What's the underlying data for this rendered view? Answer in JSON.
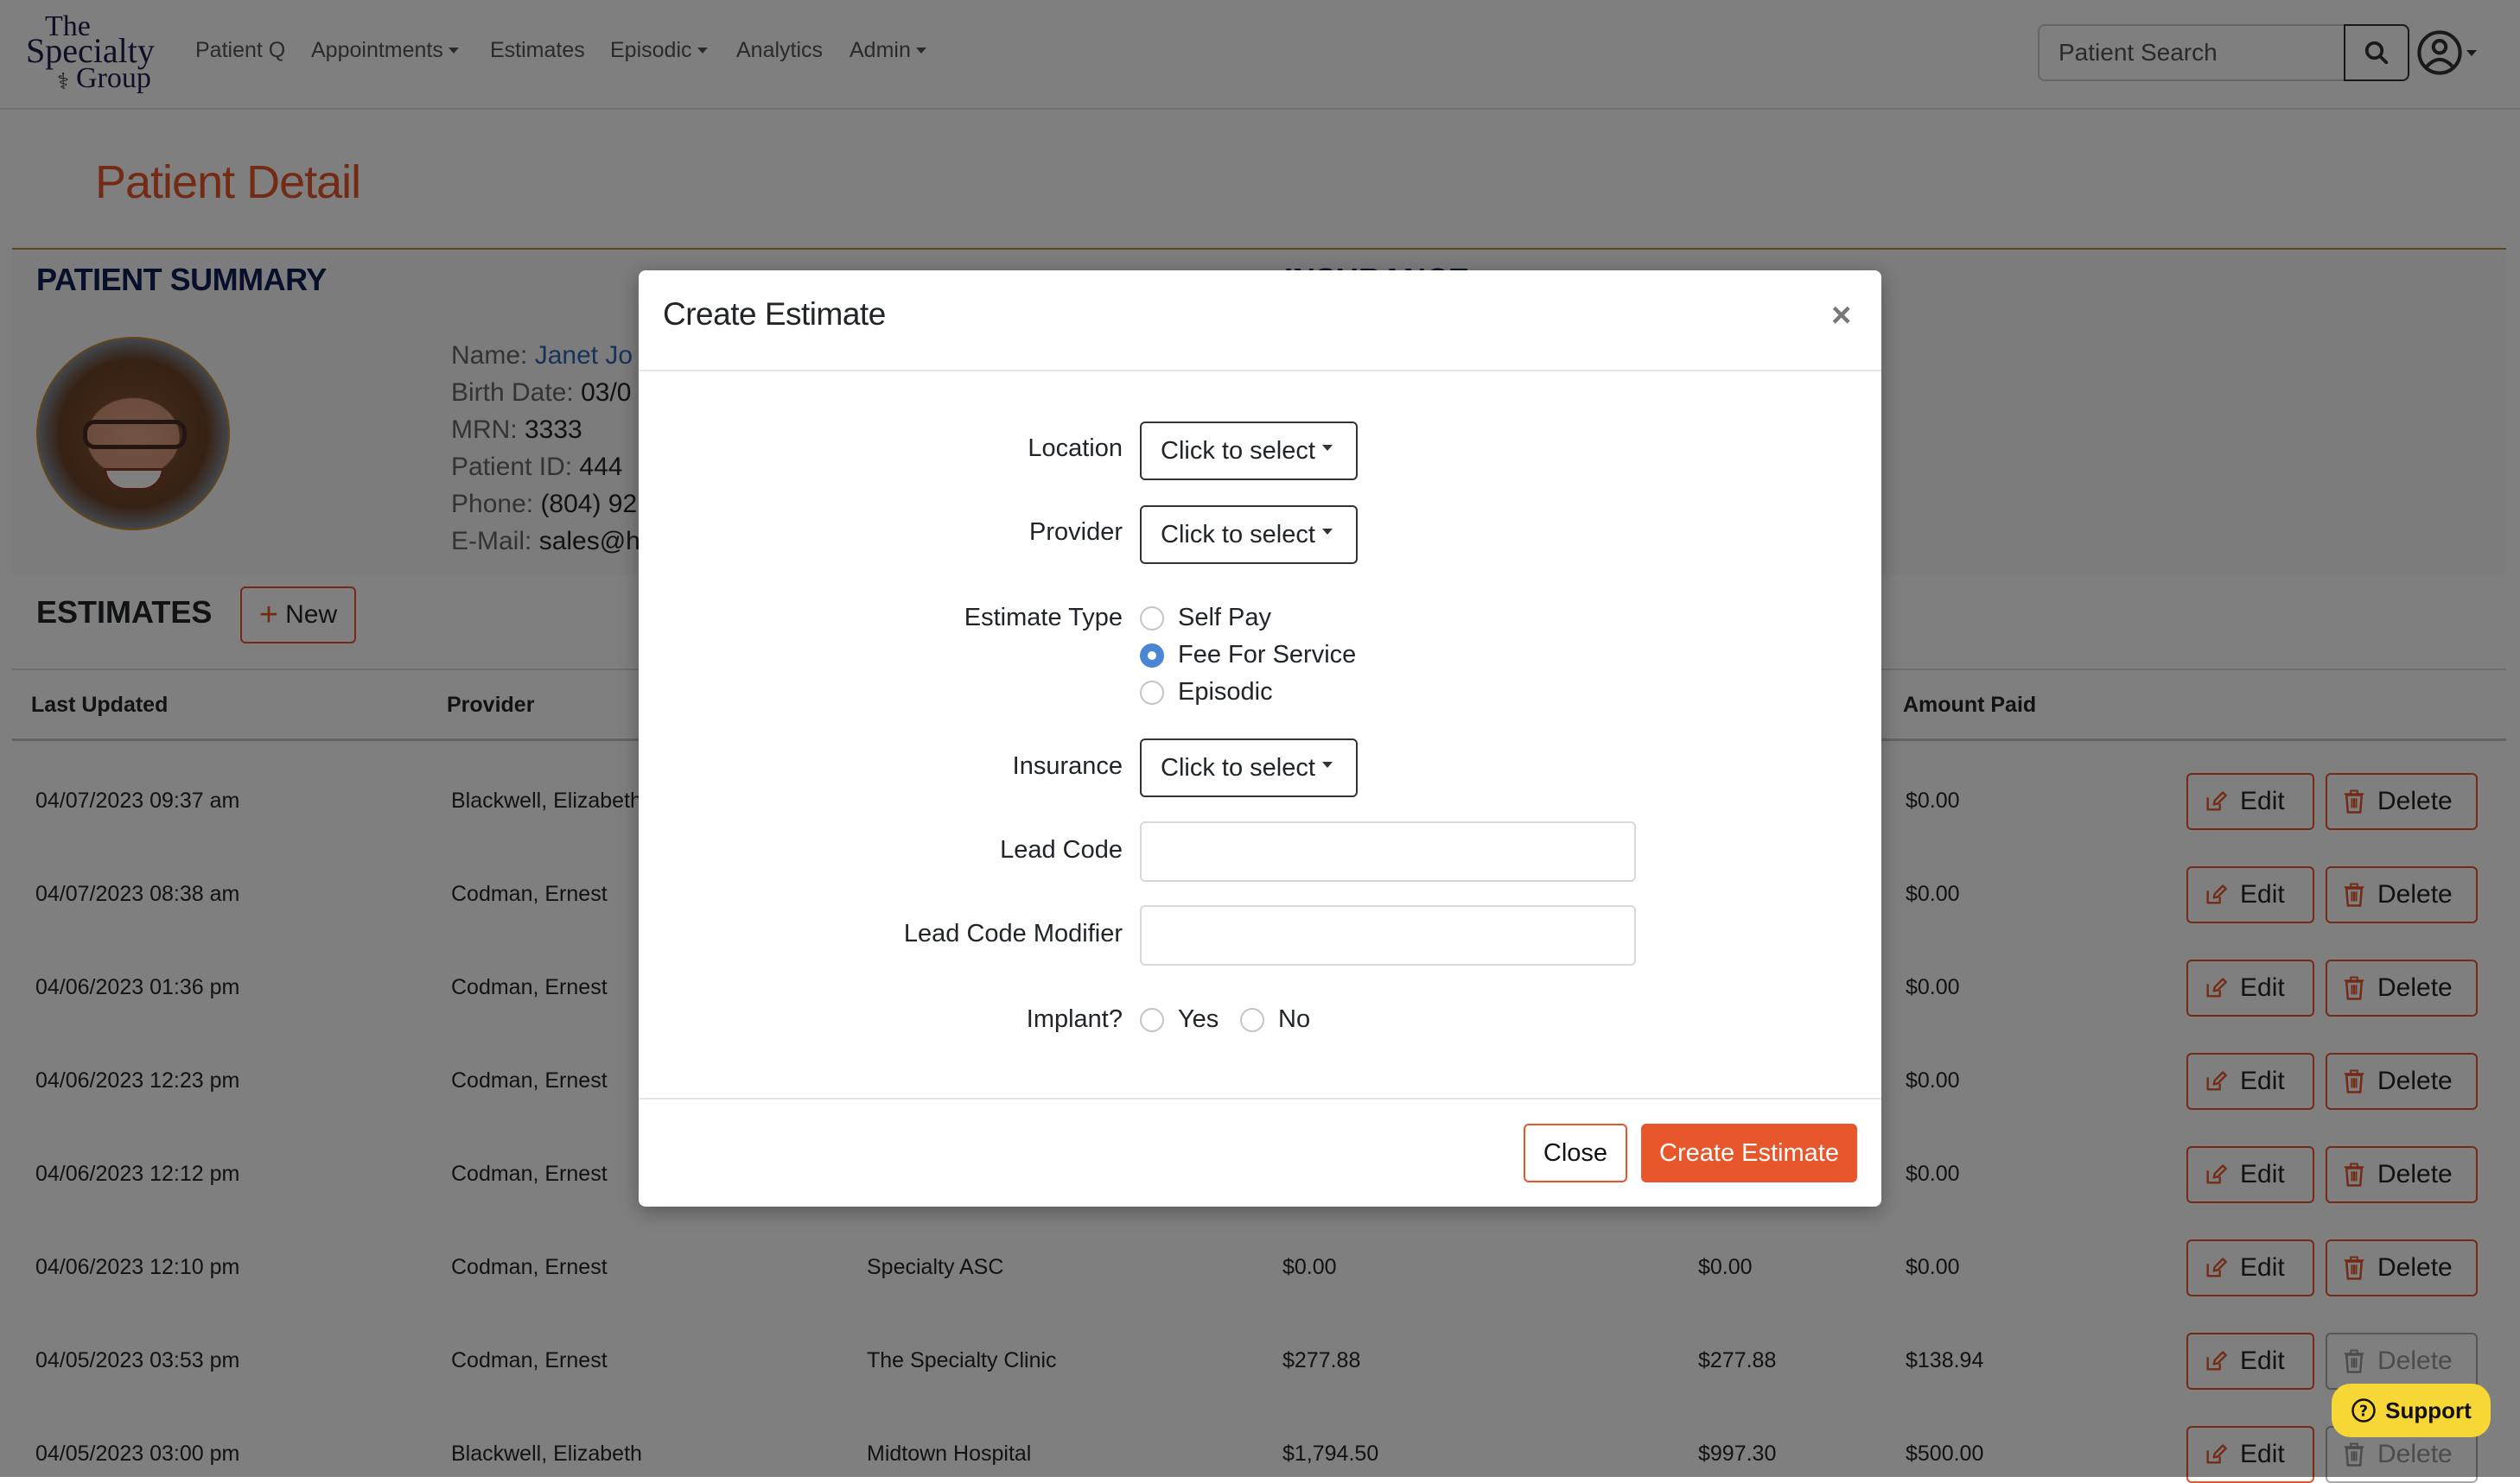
{
  "nav": {
    "logo": {
      "line1": "The",
      "line2": "Specialty",
      "line3": "Group"
    },
    "items": [
      {
        "label": "Patient Q",
        "dropdown": false
      },
      {
        "label": "Appointments",
        "dropdown": true
      },
      {
        "label": "Estimates",
        "dropdown": false
      },
      {
        "label": "Episodic",
        "dropdown": true
      },
      {
        "label": "Analytics",
        "dropdown": false
      },
      {
        "label": "Admin",
        "dropdown": true
      }
    ],
    "search": {
      "placeholder": "Patient Search",
      "value": ""
    },
    "search_icon": "search-icon",
    "user_icon": "user-circle-icon"
  },
  "page": {
    "title": "Patient Detail",
    "summary_title": "PATIENT SUMMARY",
    "insurance_title": "INSURANCE",
    "patient": {
      "name_label": "Name:",
      "name": "Janet Jo",
      "birth_label": "Birth Date:",
      "birth": "03/0",
      "mrn_label": "MRN:",
      "mrn": "3333",
      "pid_label": "Patient ID:",
      "pid": "444",
      "phone_label": "Phone:",
      "phone": "(804) 92",
      "email_label": "E-Mail:",
      "email": "sales@h"
    },
    "estimates_title": "ESTIMATES",
    "new_label": "New"
  },
  "table": {
    "headers": [
      "Last Updated",
      "Provider",
      "",
      "",
      "",
      "Amount Paid"
    ],
    "edit_label": "Edit",
    "delete_label": "Delete",
    "rows": [
      {
        "updated": "04/07/2023 09:37 am",
        "provider": "Blackwell, Elizabeth",
        "location": "",
        "c4": "",
        "c5": "",
        "paid": "$0.00",
        "delete_enabled": true
      },
      {
        "updated": "04/07/2023 08:38 am",
        "provider": "Codman, Ernest",
        "location": "",
        "c4": "",
        "c5": "",
        "paid": "$0.00",
        "delete_enabled": true
      },
      {
        "updated": "04/06/2023 01:36 pm",
        "provider": "Codman, Ernest",
        "location": "",
        "c4": "",
        "c5": "",
        "paid": "$0.00",
        "delete_enabled": true
      },
      {
        "updated": "04/06/2023 12:23 pm",
        "provider": "Codman, Ernest",
        "location": "",
        "c4": "",
        "c5": "",
        "paid": "$0.00",
        "delete_enabled": true
      },
      {
        "updated": "04/06/2023 12:12 pm",
        "provider": "Codman, Ernest",
        "location": "",
        "c4": "",
        "c5": "",
        "paid": "$0.00",
        "delete_enabled": true
      },
      {
        "updated": "04/06/2023 12:10 pm",
        "provider": "Codman, Ernest",
        "location": "Specialty ASC",
        "c4": "$0.00",
        "c5": "$0.00",
        "paid": "$0.00",
        "delete_enabled": true
      },
      {
        "updated": "04/05/2023 03:53 pm",
        "provider": "Codman, Ernest",
        "location": "The Specialty Clinic",
        "c4": "$277.88",
        "c5": "$277.88",
        "paid": "$138.94",
        "delete_enabled": false
      },
      {
        "updated": "04/05/2023 03:00 pm",
        "provider": "Blackwell, Elizabeth",
        "location": "Midtown Hospital",
        "c4": "$1,794.50",
        "c5": "$997.30",
        "paid": "$500.00",
        "delete_enabled": false
      }
    ]
  },
  "support": {
    "label": "Support"
  },
  "modal": {
    "title": "Create Estimate",
    "close_symbol": "×",
    "location_label": "Location",
    "location_value": "Click to select",
    "provider_label": "Provider",
    "provider_value": "Click to select",
    "estimate_type_label": "Estimate Type",
    "estimate_types": [
      {
        "label": "Self Pay",
        "checked": false
      },
      {
        "label": "Fee For Service",
        "checked": true
      },
      {
        "label": "Episodic",
        "checked": false
      }
    ],
    "insurance_label": "Insurance",
    "insurance_value": "Click to select",
    "lead_code_label": "Lead Code",
    "lead_code_value": "",
    "lead_code_modifier_label": "Lead Code Modifier",
    "lead_code_modifier_value": "",
    "implant_label": "Implant?",
    "implant_options": [
      {
        "label": "Yes",
        "checked": false
      },
      {
        "label": "No",
        "checked": false
      }
    ],
    "close_label": "Close",
    "create_label": "Create Estimate"
  },
  "colors": {
    "accent": "#e8572b",
    "heading": "#0f1e55",
    "gold": "#c78a2e",
    "radio": "#4a86d1",
    "support": "#f7d736"
  }
}
